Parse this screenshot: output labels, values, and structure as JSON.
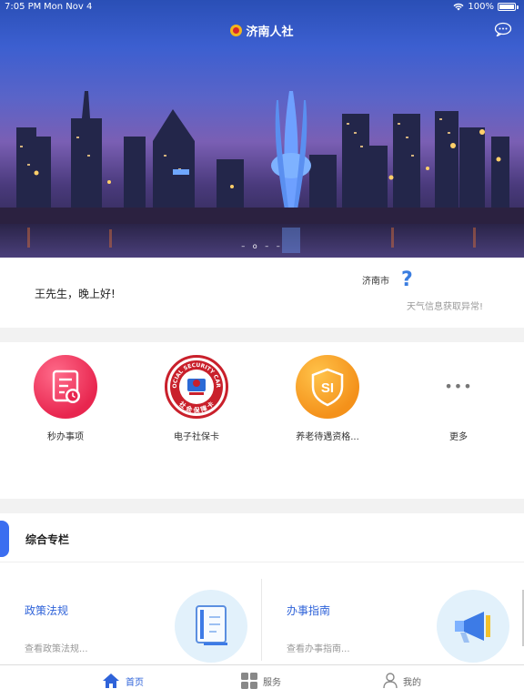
{
  "status_bar": {
    "time": "7:05 PM",
    "date": "Mon Nov 4",
    "battery": "100%"
  },
  "header": {
    "title": "济南人社",
    "logo_icon": "jinan-hrss-logo-icon",
    "message_icon": "chat-bubble-icon"
  },
  "banner": {
    "page_indicator": "– o – –"
  },
  "greeting": {
    "text": "王先生，晚上好!",
    "city": "济南市",
    "weather_icon": "question-mark-icon",
    "weather_status": "天气信息获取异常!"
  },
  "services": [
    {
      "label": "秒办事项",
      "icon": "document-clock-icon",
      "color": "#e8264f"
    },
    {
      "label": "电子社保卡",
      "icon": "social-security-card-seal-icon",
      "color": "#c9202b"
    },
    {
      "label": "养老待遇资格...",
      "icon": "si-shield-icon",
      "color": "#f4911a"
    },
    {
      "label": "更多",
      "icon": "more-dots-icon",
      "dots": "•••"
    }
  ],
  "section": {
    "title": "综合专栏",
    "cards": [
      {
        "title": "政策法规",
        "subtitle": "查看政策法规...",
        "icon": "book-icon"
      },
      {
        "title": "办事指南",
        "subtitle": "查看办事指南...",
        "icon": "megaphone-icon"
      }
    ]
  },
  "seal": {
    "top_text": "SOCIAL SECURITY CARD",
    "bottom_text": "社会保障卡"
  },
  "tabbar": [
    {
      "label": "首页",
      "icon": "home-icon",
      "active": true
    },
    {
      "label": "服务",
      "icon": "grid-icon",
      "active": false
    },
    {
      "label": "我的",
      "icon": "person-icon",
      "active": false
    }
  ],
  "colors": {
    "accent": "#2f63d9",
    "section_tab": "#3b6ef0",
    "background": "#f2f2f2"
  }
}
